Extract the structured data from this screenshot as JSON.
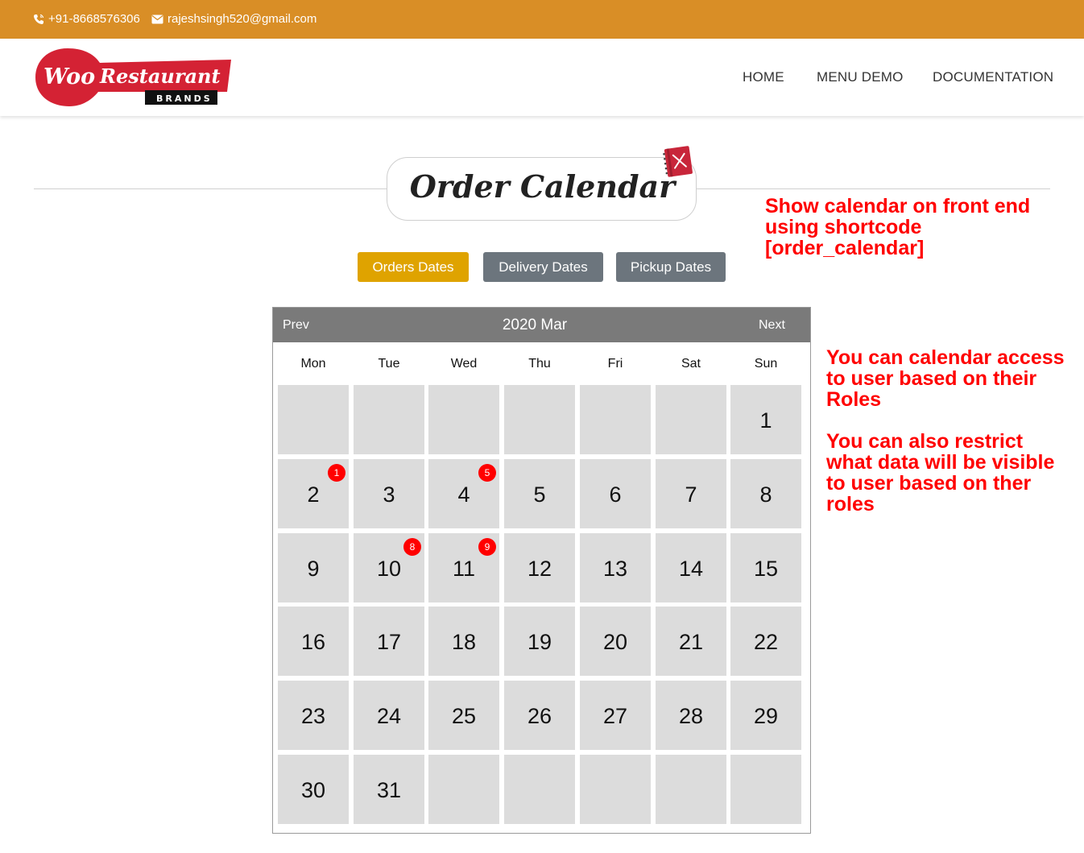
{
  "topbar": {
    "phone": "+91-8668576306",
    "email": "rajeshsingh520@gmail.com",
    "bg_color": "#d98e26"
  },
  "header": {
    "logo_text": "Woo Restaurant",
    "logo_subtext": "BRANDS",
    "nav": [
      "HOME",
      "MENU DEMO",
      "DOCUMENTATION"
    ]
  },
  "page": {
    "title": "Order Calendar",
    "buttons": [
      "Orders Dates",
      "Delivery Dates",
      "Pickup Dates"
    ],
    "active_button_color": "#dfa300",
    "inactive_button_color": "#6c757d"
  },
  "calendar": {
    "prev": "Prev",
    "next": "Next",
    "title": "2020 Mar",
    "days_of_week": [
      "Mon",
      "Tue",
      "Wed",
      "Thu",
      "Fri",
      "Sat",
      "Sun"
    ],
    "first_weekday_index": 6,
    "days_in_month": 31,
    "weeks": 6,
    "badges": {
      "2": "1",
      "4": "5",
      "10": "8",
      "11": "9"
    }
  },
  "notes": [
    "Show calendar on front end\nusing shortcode\n[order_calendar]",
    "You can calendar access\nto user based on their\nRoles",
    "You can also restrict\nwhat data will be visible\nto user based on ther\nroles"
  ],
  "icons": [
    "phone-icon",
    "envelope-icon",
    "menu-book-icon"
  ]
}
